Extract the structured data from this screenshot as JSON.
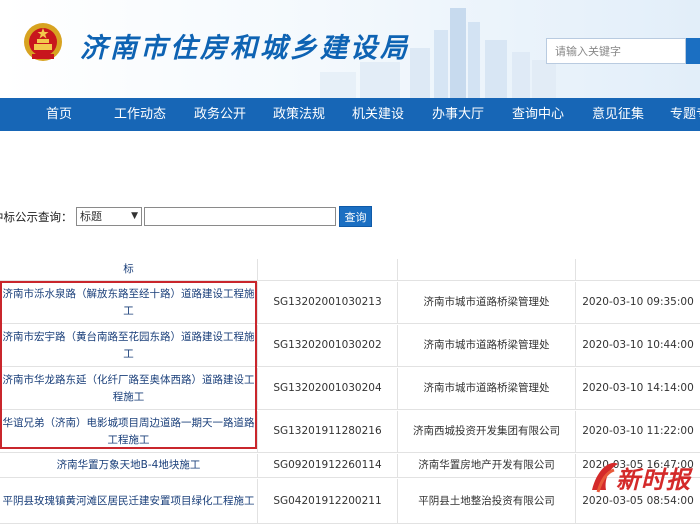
{
  "header": {
    "site_title": "济南市住房和城乡建设局",
    "search_placeholder": "请输入关键字"
  },
  "nav": {
    "items": [
      "首页",
      "工作动态",
      "政务公开",
      "政策法规",
      "机关建设",
      "办事大厅",
      "查询中心",
      "意见征集",
      "专题专"
    ]
  },
  "query": {
    "label": "中标公示查询：",
    "select_value": "标题",
    "button": "查询"
  },
  "table": {
    "rows": [
      {
        "project": "标",
        "code": "",
        "unit": "",
        "date": ""
      },
      {
        "project": "济南市泺水泉路（解放东路至经十路）道路建设工程施工",
        "code": "SG13202001030213",
        "unit": "济南市城市道路桥梁管理处",
        "date": "2020-03-10 09:35:00"
      },
      {
        "project": "济南市宏宇路（黄台南路至花园东路）道路建设工程施工",
        "code": "SG13202001030202",
        "unit": "济南市城市道路桥梁管理处",
        "date": "2020-03-10 10:44:00"
      },
      {
        "project": "济南市华龙路东延（化纤厂路至奥体西路）道路建设工程施工",
        "code": "SG13202001030204",
        "unit": "济南市城市道路桥梁管理处",
        "date": "2020-03-10 14:14:00"
      },
      {
        "project": "华谊兄弟（济南）电影城项目周边道路一期天一路道路工程施工",
        "code": "SG13201911280216",
        "unit": "济南西城投资开发集团有限公司",
        "date": "2020-03-10 11:22:00"
      },
      {
        "project": "济南华置万象天地B-4地块施工",
        "code": "SG09201912260114",
        "unit": "济南华置房地产开发有限公司",
        "date": "2020-03-05 16:47:00"
      },
      {
        "project": "平阴县玫瑰镇黄河滩区居民迁建安置项目绿化工程施工",
        "code": "SG04201912200211",
        "unit": "平阴县土地整治投资有限公司",
        "date": "2020-03-05 08:54:00"
      }
    ]
  },
  "watermark": {
    "text": "新时报"
  },
  "colors": {
    "primary_blue": "#1766b6",
    "title_blue": "#0e63b3",
    "highlight_red": "#c9262c"
  }
}
